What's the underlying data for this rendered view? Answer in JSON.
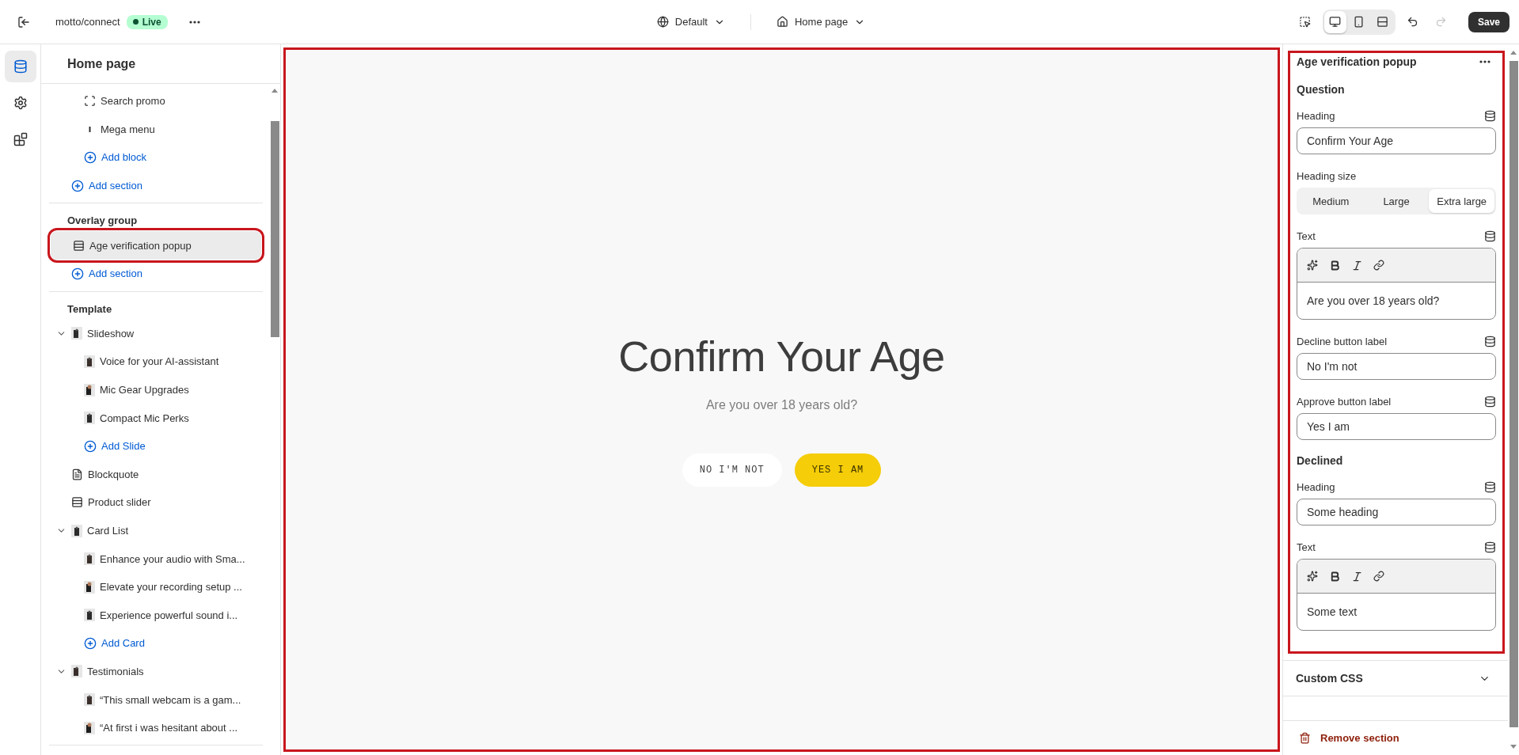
{
  "topbar": {
    "store": "motto/connect",
    "status": "Live",
    "theme": "Default",
    "page": "Home page",
    "views": [
      {
        "selected": true
      },
      {
        "selected": false
      },
      {
        "selected": false
      }
    ],
    "redo_disabled": true,
    "save": "Save"
  },
  "rail": [
    {
      "selected": true
    },
    {
      "selected": false
    },
    {
      "selected": false
    }
  ],
  "sidebar": {
    "title": "Home page",
    "groups": [
      {
        "items": [
          {
            "kind": "offscreen-parent",
            "children": [
              {
                "kind": "frame",
                "label": "Search promo",
                "selected": false
              },
              {
                "kind": "bar",
                "label": "Mega menu",
                "selected": false
              },
              {
                "kind": "add",
                "label": "Add block"
              }
            ]
          },
          {
            "kind": "add",
            "label": "Add section"
          }
        ]
      },
      {
        "label": "Overlay group",
        "items": [
          {
            "kind": "section",
            "label": "Age verification popup",
            "selected": true,
            "highlighted": true
          },
          {
            "kind": "add",
            "label": "Add section"
          }
        ]
      },
      {
        "label": "Template",
        "items": [
          {
            "kind": "thumb",
            "label": "Slideshow",
            "selected": false,
            "expanded": true,
            "children": [
              {
                "kind": "thumb",
                "label": "Voice for your AI-assistant",
                "selected": false
              },
              {
                "kind": "thumb",
                "label": "Mic Gear Upgrades",
                "selected": false
              },
              {
                "kind": "thumb",
                "label": "Compact Mic Perks",
                "selected": false
              },
              {
                "kind": "add",
                "label": "Add Slide"
              }
            ]
          },
          {
            "kind": "text",
            "label": "Blockquote",
            "selected": false
          },
          {
            "kind": "section",
            "label": "Product slider",
            "selected": false
          },
          {
            "kind": "thumb",
            "label": "Card List",
            "selected": false,
            "expanded": true,
            "children": [
              {
                "kind": "thumb",
                "label": "Enhance your audio with Sma...",
                "selected": false
              },
              {
                "kind": "thumb",
                "label": "Elevate your recording setup ...",
                "selected": false
              },
              {
                "kind": "thumb",
                "label": "Experience powerful sound i...",
                "selected": false
              },
              {
                "kind": "add",
                "label": "Add Card"
              }
            ]
          },
          {
            "kind": "thumb",
            "label": "Testimonials",
            "selected": false,
            "expanded": true,
            "children": [
              {
                "kind": "thumb",
                "label": "“This small webcam is a gam...",
                "selected": false
              },
              {
                "kind": "thumb",
                "label": "“At first i was hesitant about ...",
                "selected": false
              }
            ]
          }
        ]
      }
    ]
  },
  "preview": {
    "highlighted": true,
    "heading": "Confirm Your Age",
    "text": "Are you over 18 years old?",
    "buttons": [
      {
        "kind": "decline",
        "label": "NO I'M NOT"
      },
      {
        "kind": "approve",
        "label": "YES I AM"
      }
    ]
  },
  "settings": {
    "highlighted": true,
    "title": "Age verification popup",
    "sections": [
      {
        "title": "Question",
        "fields": [
          {
            "kind": "text",
            "label": "Heading",
            "dynamic": true,
            "value": "Confirm Your Age"
          },
          {
            "kind": "segmented",
            "label": "Heading size",
            "options": [
              {
                "label": "Medium",
                "selected": false
              },
              {
                "label": "Large",
                "selected": false
              },
              {
                "label": "Extra large",
                "selected": true
              }
            ]
          },
          {
            "kind": "richtext",
            "label": "Text",
            "dynamic": true,
            "value": "Are you over 18 years old?"
          },
          {
            "kind": "text",
            "label": "Decline button label",
            "dynamic": true,
            "value": "No I'm not"
          },
          {
            "kind": "text",
            "label": "Approve button label",
            "dynamic": true,
            "value": "Yes I am"
          }
        ]
      },
      {
        "title": "Declined",
        "fields": [
          {
            "kind": "text",
            "label": "Heading",
            "dynamic": true,
            "value": "Some heading"
          },
          {
            "kind": "richtext",
            "label": "Text",
            "dynamic": true,
            "value": "Some text"
          }
        ]
      }
    ],
    "custom_css": {
      "label": "Custom CSS",
      "expanded": false
    },
    "remove": "Remove section"
  }
}
